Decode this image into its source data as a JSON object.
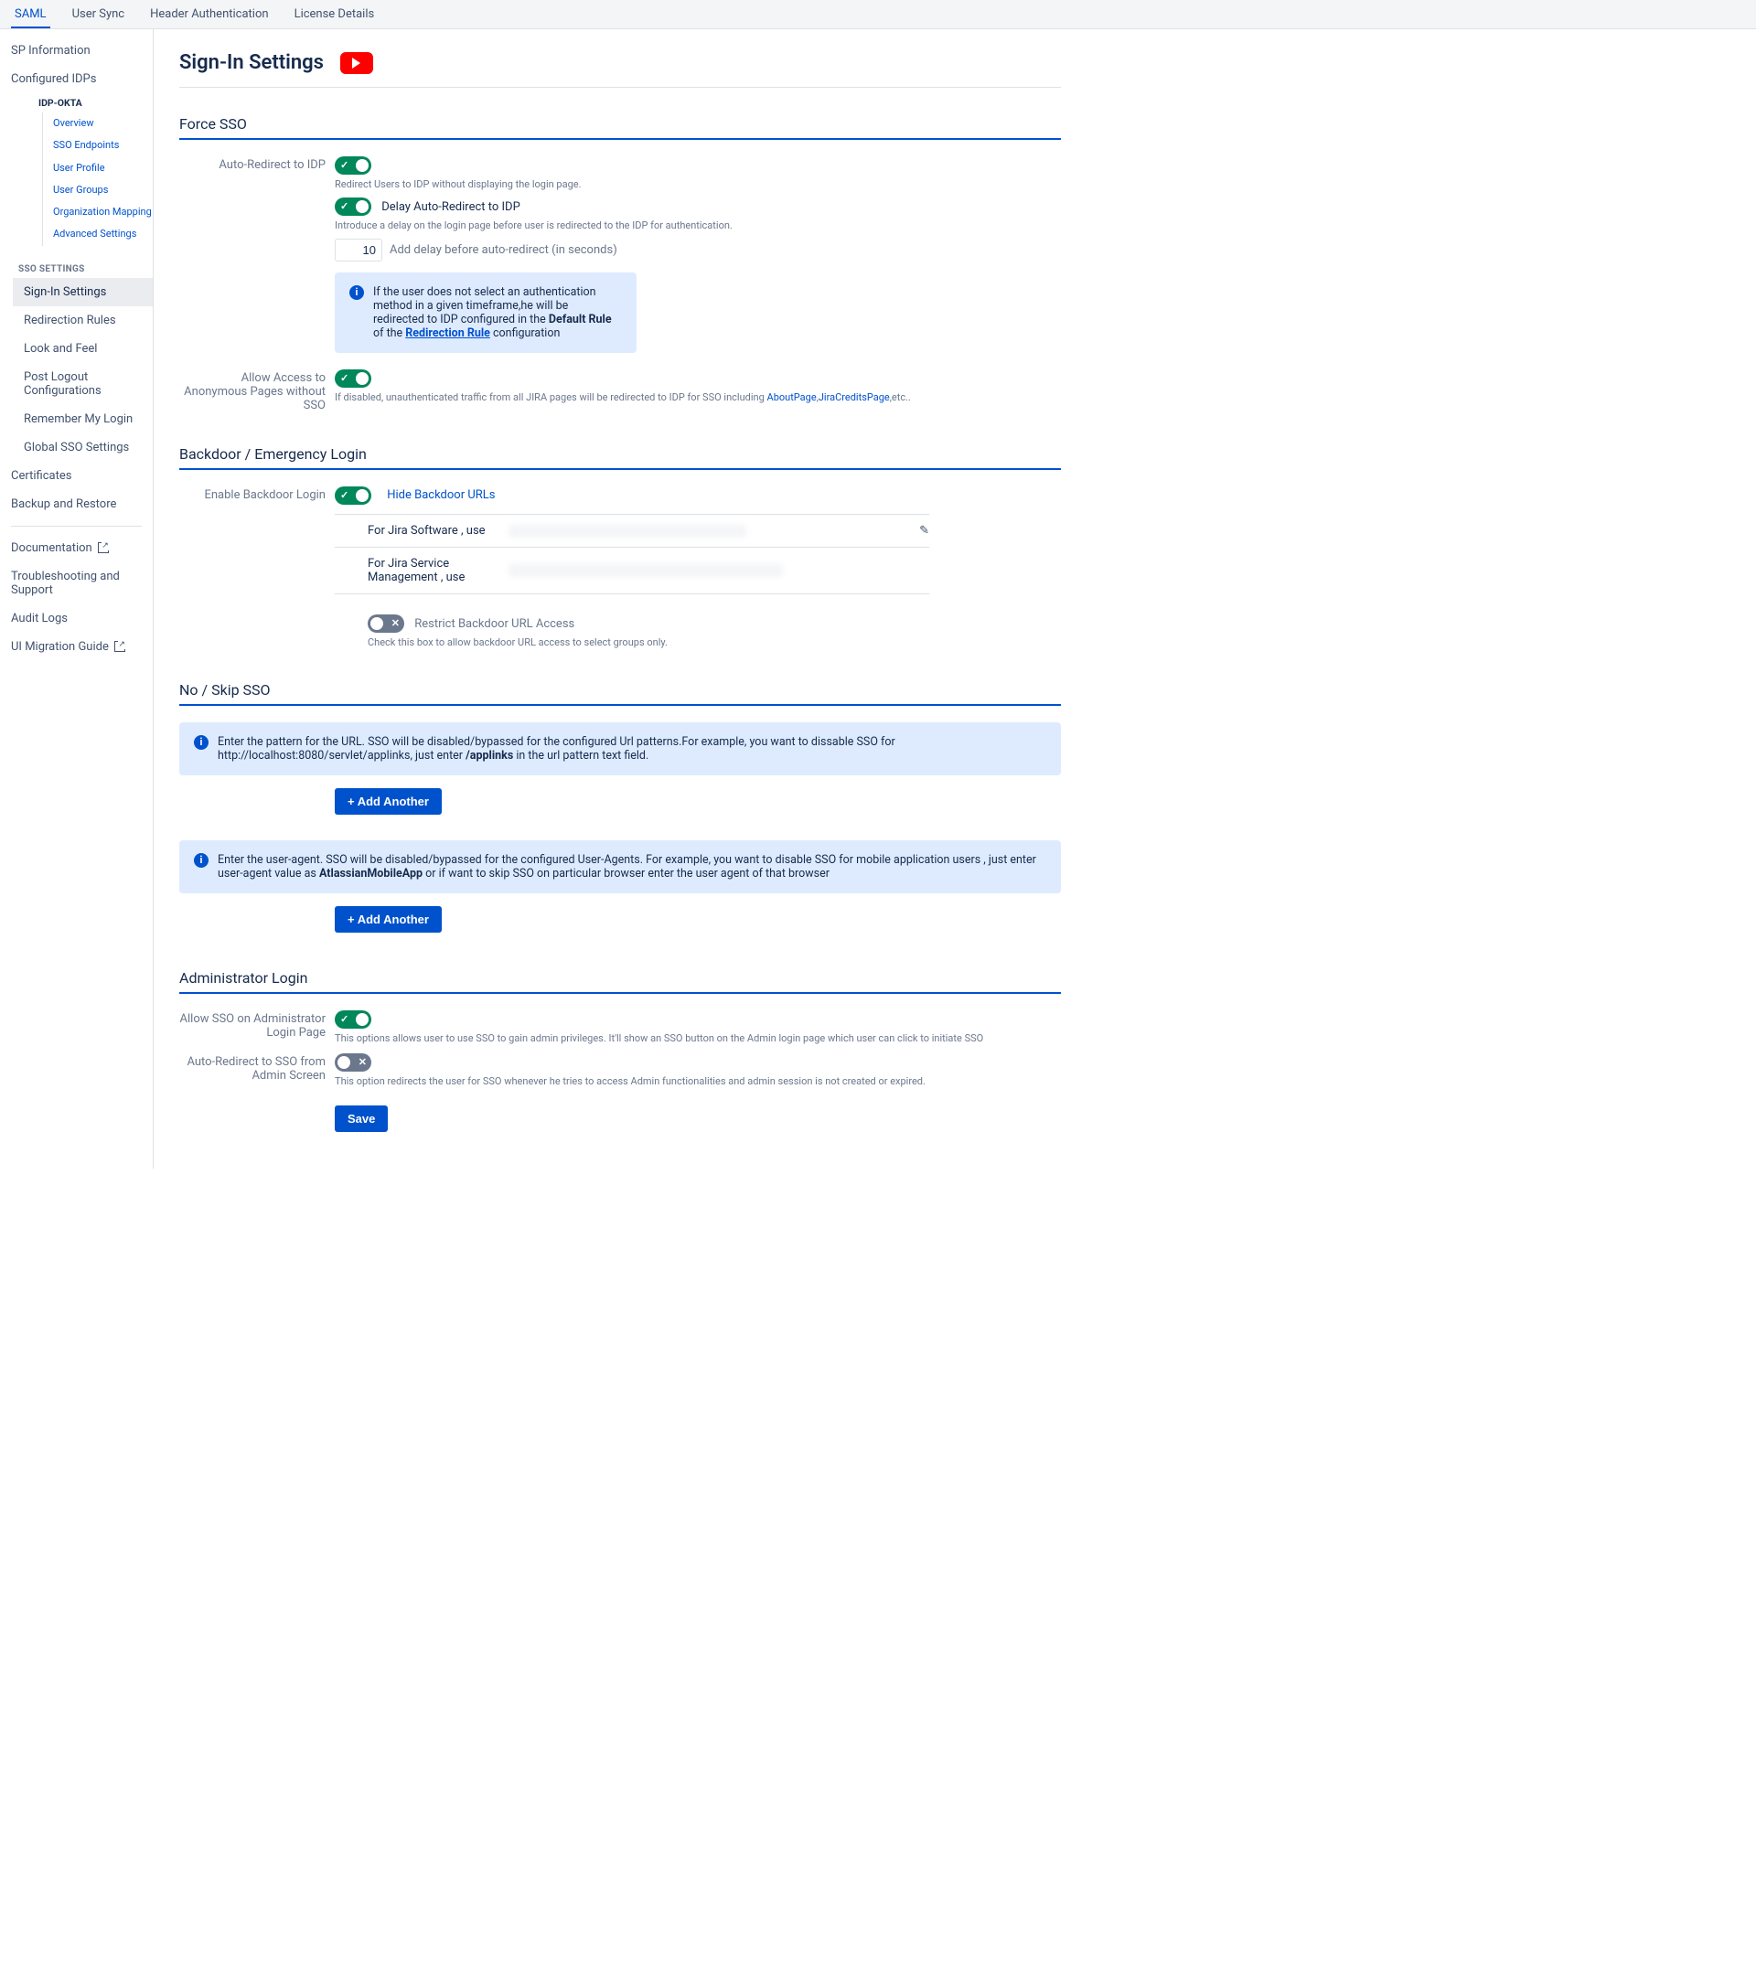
{
  "topnav": {
    "tabs": [
      "SAML",
      "User Sync",
      "Header Authentication",
      "License Details"
    ]
  },
  "sidebar": {
    "items_a": [
      "SP Information",
      "Configured IDPs"
    ],
    "idp_header": "IDP-OKTA",
    "idp_tree": [
      "Overview",
      "SSO Endpoints",
      "User Profile",
      "User Groups",
      "Organization Mapping",
      "Advanced Settings"
    ],
    "sso_header": "SSO SETTINGS",
    "sso_items": [
      "Sign-In Settings",
      "Redirection Rules",
      "Look and Feel",
      "Post Logout Configurations",
      "Remember My Login",
      "Global SSO Settings"
    ],
    "items_b": [
      "Certificates",
      "Backup and Restore"
    ],
    "items_c": [
      "Documentation",
      "Troubleshooting and Support",
      "Audit Logs",
      "UI Migration Guide"
    ]
  },
  "page": {
    "title": "Sign-In Settings"
  },
  "force_sso": {
    "title": "Force SSO",
    "auto_redirect_label": "Auto-Redirect to IDP",
    "auto_redirect_help": "Redirect Users to IDP without displaying the login page.",
    "delay_label": "Delay Auto-Redirect to IDP",
    "delay_help": "Introduce a delay on the login page before user is redirected to the IDP for authentication.",
    "delay_value": "10",
    "delay_placeholder": "Add delay before auto-redirect (in seconds)",
    "info_pre": "If the user does not select an authentication method in a given timeframe,he will be redirected to IDP configured in the ",
    "info_bold1": "Default Rule",
    "info_mid": " of the ",
    "info_link": "Redirection Rule",
    "info_post": " configuration",
    "anon_label": "Allow Access to Anonymous Pages without SSO",
    "anon_help_pre": "If disabled, unauthenticated traffic from all JIRA pages will be redirected to IDP for SSO including ",
    "anon_link1": "AboutPage",
    "anon_sep": ",",
    "anon_link2": "JiraCreditsPage",
    "anon_help_post": ",etc.."
  },
  "backdoor": {
    "title": "Backdoor / Emergency Login",
    "enable_label": "Enable Backdoor Login",
    "hide_link": "Hide Backdoor URLs",
    "url_rows": [
      {
        "label": "For Jira Software , use",
        "has_edit": true
      },
      {
        "label": "For Jira Service Management , use",
        "has_edit": false
      }
    ],
    "restrict_label": "Restrict Backdoor URL Access",
    "restrict_help": "Check this box to allow backdoor URL access to select groups only."
  },
  "noskip": {
    "title": "No / Skip SSO",
    "info1_pre": "Enter the pattern for the URL. SSO will be disabled/bypassed for the configured Url patterns.For example, you want to dissable SSO for http://localhost:8080/servlet/applinks, just enter ",
    "info1_bold": "/applinks",
    "info1_post": " in the url pattern text field.",
    "info2_pre": "Enter the user-agent. SSO will be disabled/bypassed for the configured User-Agents. For example, you want to disable SSO for mobile application users , just enter user-agent value as ",
    "info2_bold": "AtlassianMobileApp",
    "info2_post": " or if want to skip SSO on particular browser enter the user agent of that browser",
    "add_btn": "+ Add Another"
  },
  "admin": {
    "title": "Administrator Login",
    "allow_label": "Allow SSO on Administrator Login Page",
    "allow_help": "This options allows user to use SSO to gain admin privileges. It'll show an SSO button on the Admin login page which user can click to initiate SSO",
    "auto_label": "Auto-Redirect to SSO from Admin Screen",
    "auto_help": "This option redirects the user for SSO whenever he tries to access Admin functionalities and admin session is not created or expired.",
    "save": "Save"
  }
}
